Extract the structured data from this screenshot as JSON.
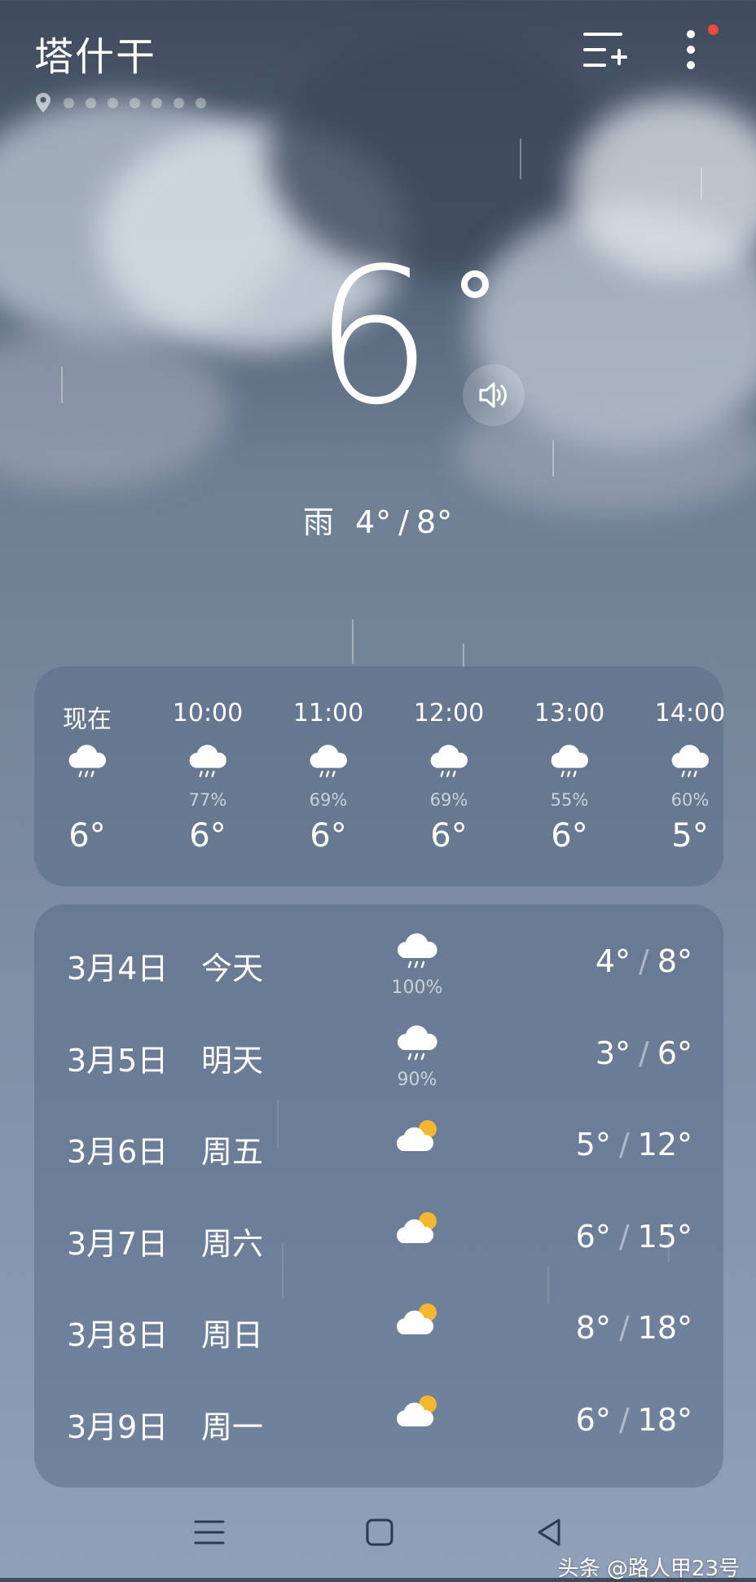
{
  "header": {
    "city": "塔什干",
    "page_dots_count": 7,
    "icons": [
      "location-icon",
      "add-city-icon",
      "more-menu-icon"
    ],
    "notification_color": "#f04a3e"
  },
  "current": {
    "temperature": "6",
    "condition": "雨",
    "low": "4°",
    "range_sep": "/",
    "high": "8°"
  },
  "hourly": [
    {
      "time": "现在",
      "icon": "rain-cloud-icon",
      "precip": "",
      "temp": "6°"
    },
    {
      "time": "10:00",
      "icon": "rain-cloud-icon",
      "precip": "77%",
      "temp": "6°"
    },
    {
      "time": "11:00",
      "icon": "rain-cloud-icon",
      "precip": "69%",
      "temp": "6°"
    },
    {
      "time": "12:00",
      "icon": "rain-cloud-icon",
      "precip": "69%",
      "temp": "6°"
    },
    {
      "time": "13:00",
      "icon": "rain-cloud-icon",
      "precip": "55%",
      "temp": "6°"
    },
    {
      "time": "14:00",
      "icon": "rain-cloud-icon",
      "precip": "60%",
      "temp": "5°"
    }
  ],
  "daily": [
    {
      "date": "3月4日",
      "weekday": "今天",
      "icon": "rain-cloud-icon",
      "precip": "100%",
      "low": "4°",
      "high": "8°"
    },
    {
      "date": "3月5日",
      "weekday": "明天",
      "icon": "rain-cloud-icon",
      "precip": "90%",
      "low": "3°",
      "high": "6°"
    },
    {
      "date": "3月6日",
      "weekday": "周五",
      "icon": "partly-cloudy-icon",
      "precip": "",
      "low": "5°",
      "high": "12°"
    },
    {
      "date": "3月7日",
      "weekday": "周六",
      "icon": "partly-cloudy-icon",
      "precip": "",
      "low": "6°",
      "high": "15°"
    },
    {
      "date": "3月8日",
      "weekday": "周日",
      "icon": "partly-cloudy-icon",
      "precip": "",
      "low": "8°",
      "high": "18°"
    },
    {
      "date": "3月9日",
      "weekday": "周一",
      "icon": "partly-cloudy-icon",
      "precip": "",
      "low": "6°",
      "high": "18°"
    }
  ],
  "range_sep": "/",
  "navbar": {
    "icons": [
      "menu-nav-icon",
      "home-nav-icon",
      "back-nav-icon"
    ]
  },
  "watermark": "头条 @路人甲23号"
}
